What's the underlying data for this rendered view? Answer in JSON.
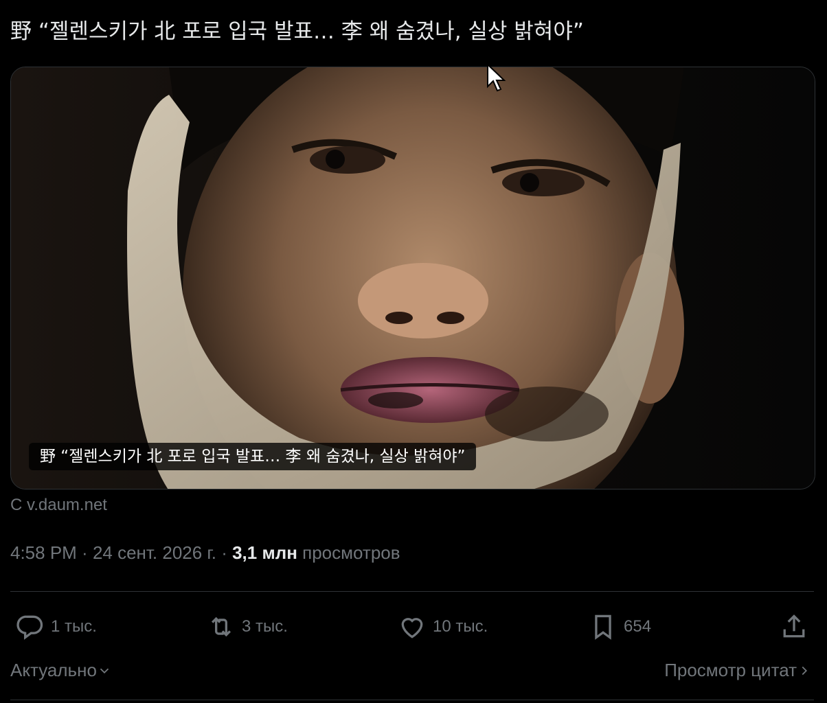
{
  "tweet": {
    "headline": "野 “젤렌스키가 北 포로 입국 발표… 李 왜 숨겼나, 실상 밝혀야”",
    "card": {
      "caption": "野 “젤렌스키가 北 포로 입국 발표… 李 왜 숨겼나, 실상 밝혀야”",
      "source": "С v.daum.net"
    },
    "meta": {
      "time": "4:58 PM",
      "sep1": " · ",
      "date": "24 сент. 2026 г.",
      "sep2": " · ",
      "views_count": "3,1 млн",
      "views_label": " просмотров"
    },
    "actions": {
      "reply_count": "1 тыс.",
      "retweet_count": "3 тыс.",
      "like_count": "10 тыс.",
      "bookmark_count": "654",
      "icons": [
        "reply-icon",
        "retweet-icon",
        "like-icon",
        "bookmark-icon",
        "share-icon"
      ]
    },
    "footer": {
      "sort_label": "Актуально",
      "quotes_label": "Просмотр цитат"
    }
  },
  "colors": {
    "background": "#000000",
    "text": "#e7e9ea",
    "muted": "#71767b",
    "divider": "#2f3336"
  }
}
